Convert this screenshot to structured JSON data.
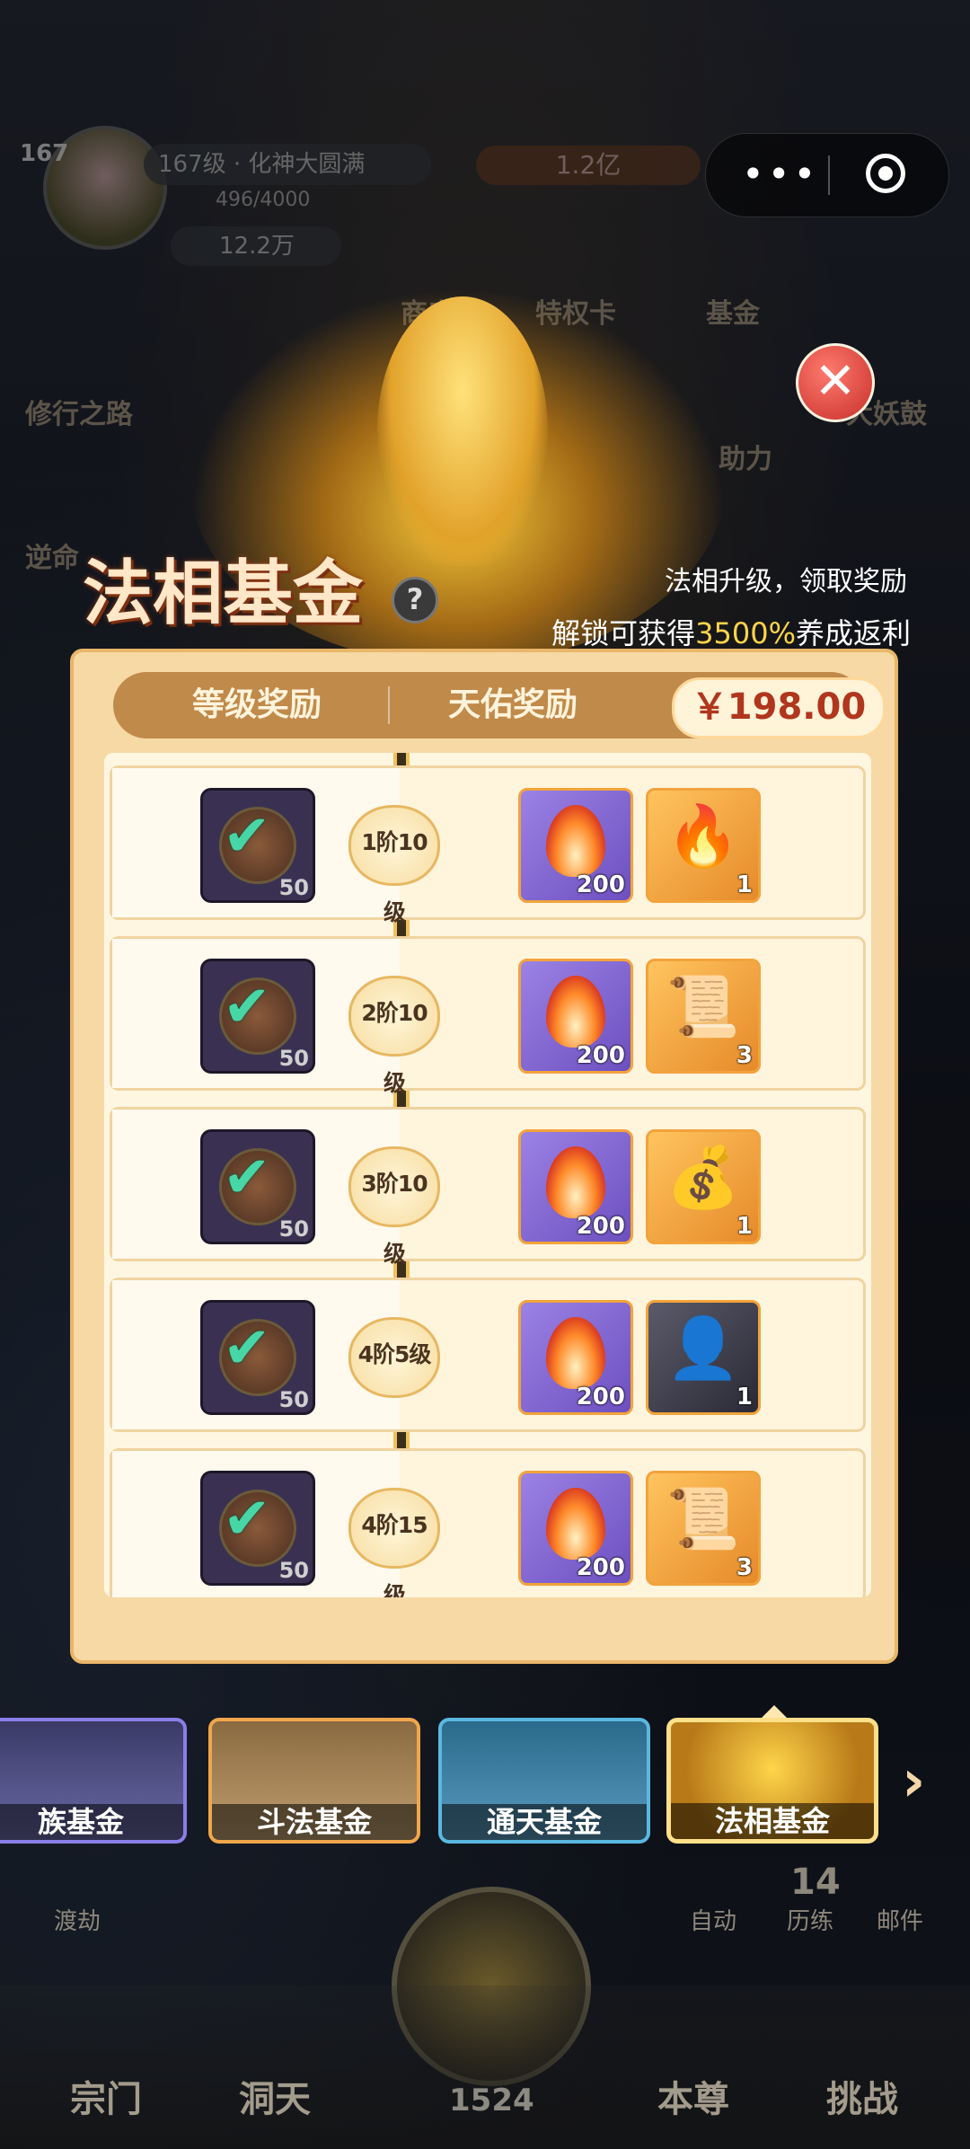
{
  "hud": {
    "level_badge": "167",
    "name_line": "167级 · 化神大圆满",
    "exp": "496/4000",
    "gems": "12.2万",
    "power": "1.2亿",
    "menu_dots": "•••"
  },
  "bg_labels": [
    "商店",
    "特权卡",
    "基金",
    "修行之路",
    "助力",
    "大妖鼓",
    "逆命"
  ],
  "popup": {
    "title": "法相基金",
    "help": "?",
    "subtitle1": "法相升级，领取奖励",
    "subtitle2_prefix": "解锁可获得",
    "subtitle2_highlight": "3500%",
    "subtitle2_suffix": "养成返利",
    "close": "✕",
    "tabs": {
      "level": "等级奖励",
      "blessing": "天佑奖励"
    },
    "price": "￥198.00"
  },
  "rewards": [
    {
      "stage": "1阶10级",
      "free_qty": "50",
      "item1_qty": "200",
      "item2_qty": "1",
      "item2_kind": "fa-xiang-card"
    },
    {
      "stage": "2阶10级",
      "free_qty": "50",
      "item1_qty": "200",
      "item2_qty": "3",
      "item2_kind": "scroll"
    },
    {
      "stage": "3阶10级",
      "free_qty": "50",
      "item1_qty": "200",
      "item2_qty": "1",
      "item2_kind": "treasure-bag"
    },
    {
      "stage": "4阶5级",
      "free_qty": "50",
      "item1_qty": "200",
      "item2_qty": "1",
      "item2_kind": "hero-portrait"
    },
    {
      "stage": "4阶15级",
      "free_qty": "50",
      "item1_qty": "200",
      "item2_qty": "3",
      "item2_kind": "scroll"
    }
  ],
  "funds": [
    {
      "label": "族基金",
      "color": "#8a7ee8"
    },
    {
      "label": "斗法基金",
      "color": "#f0a64a"
    },
    {
      "label": "通天基金",
      "color": "#5ab8e0"
    },
    {
      "label": "法相基金",
      "color": "#ffe08a"
    }
  ],
  "side": {
    "auto": "自动",
    "train_count": "14",
    "train": "历练",
    "mail": "邮件",
    "dujie": "渡劫"
  },
  "nav": {
    "sect": "宗门",
    "cave": "洞天",
    "self": "本尊",
    "challenge": "挑战",
    "count": "1524"
  },
  "colors": {
    "accent": "#ffd54a",
    "price": "#b0361e",
    "check": "#47d7a6"
  }
}
